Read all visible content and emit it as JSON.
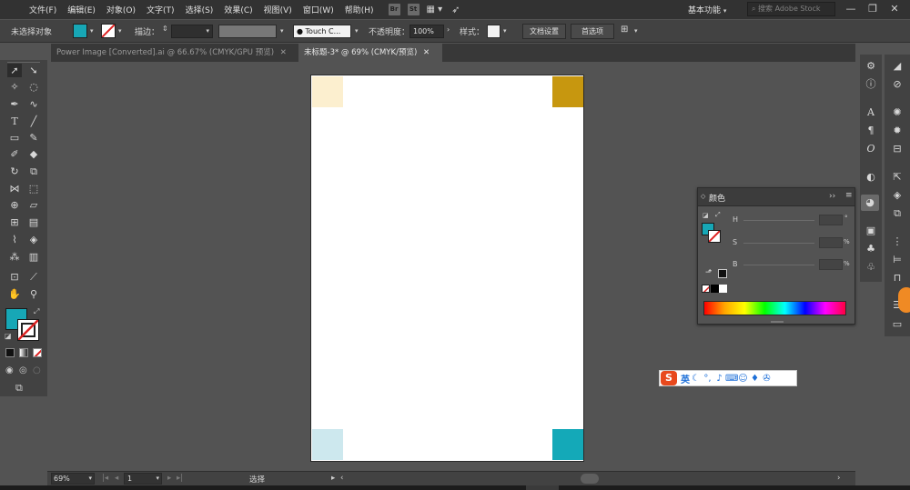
{
  "menu": {
    "items": [
      "文件(F)",
      "编辑(E)",
      "对象(O)",
      "文字(T)",
      "选择(S)",
      "效果(C)",
      "视图(V)",
      "窗口(W)",
      "帮助(H)"
    ],
    "bridge_icon": "Br",
    "stock_icon": "St",
    "workspace": "基本功能",
    "search_placeholder": "搜索 Adobe Stock"
  },
  "control": {
    "selection_status": "未选择对象",
    "stroke_label": "描边：",
    "brush_name": "Touch C...",
    "opacity_label": "不透明度：",
    "opacity_value": "100%",
    "style_label": "样式：",
    "doc_setup_button": "文档设置",
    "preferences_button": "首选项"
  },
  "tabs": [
    {
      "label": "Power Image [Converted].ai @ 66.67% (CMYK/GPU 预览)",
      "close": "✕"
    },
    {
      "label": "未标题-3* @ 69% (CMYK/预览)",
      "close": "✕"
    }
  ],
  "colors": {
    "fill": "#17a7b6",
    "swatch_top_left": "#fcefcf",
    "swatch_top_right": "#c7970f",
    "swatch_bottom_left": "#cde8ee",
    "swatch_bottom_right": "#14a9b8"
  },
  "color_panel": {
    "title": "颜色",
    "channels": [
      "H",
      "S",
      "B"
    ],
    "units": [
      "°",
      "%",
      "%"
    ]
  },
  "ime": {
    "mode": "英"
  },
  "status": {
    "zoom": "69%",
    "artboard_number": "1",
    "tool_name": "选择"
  }
}
